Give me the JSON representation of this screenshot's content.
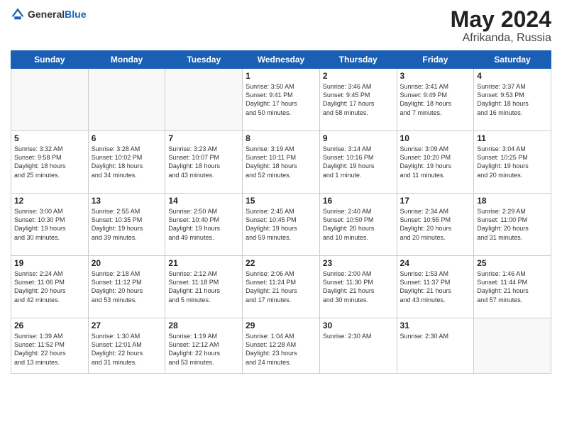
{
  "logo": {
    "general": "General",
    "blue": "Blue"
  },
  "title": {
    "month_year": "May 2024",
    "location": "Afrikanda, Russia"
  },
  "headers": [
    "Sunday",
    "Monday",
    "Tuesday",
    "Wednesday",
    "Thursday",
    "Friday",
    "Saturday"
  ],
  "weeks": [
    [
      {
        "day": "",
        "text": ""
      },
      {
        "day": "",
        "text": ""
      },
      {
        "day": "",
        "text": ""
      },
      {
        "day": "1",
        "text": "Sunrise: 3:50 AM\nSunset: 9:41 PM\nDaylight: 17 hours\nand 50 minutes."
      },
      {
        "day": "2",
        "text": "Sunrise: 3:46 AM\nSunset: 9:45 PM\nDaylight: 17 hours\nand 58 minutes."
      },
      {
        "day": "3",
        "text": "Sunrise: 3:41 AM\nSunset: 9:49 PM\nDaylight: 18 hours\nand 7 minutes."
      },
      {
        "day": "4",
        "text": "Sunrise: 3:37 AM\nSunset: 9:53 PM\nDaylight: 18 hours\nand 16 minutes."
      }
    ],
    [
      {
        "day": "5",
        "text": "Sunrise: 3:32 AM\nSunset: 9:58 PM\nDaylight: 18 hours\nand 25 minutes."
      },
      {
        "day": "6",
        "text": "Sunrise: 3:28 AM\nSunset: 10:02 PM\nDaylight: 18 hours\nand 34 minutes."
      },
      {
        "day": "7",
        "text": "Sunrise: 3:23 AM\nSunset: 10:07 PM\nDaylight: 18 hours\nand 43 minutes."
      },
      {
        "day": "8",
        "text": "Sunrise: 3:19 AM\nSunset: 10:11 PM\nDaylight: 18 hours\nand 52 minutes."
      },
      {
        "day": "9",
        "text": "Sunrise: 3:14 AM\nSunset: 10:16 PM\nDaylight: 19 hours\nand 1 minute."
      },
      {
        "day": "10",
        "text": "Sunrise: 3:09 AM\nSunset: 10:20 PM\nDaylight: 19 hours\nand 11 minutes."
      },
      {
        "day": "11",
        "text": "Sunrise: 3:04 AM\nSunset: 10:25 PM\nDaylight: 19 hours\nand 20 minutes."
      }
    ],
    [
      {
        "day": "12",
        "text": "Sunrise: 3:00 AM\nSunset: 10:30 PM\nDaylight: 19 hours\nand 30 minutes."
      },
      {
        "day": "13",
        "text": "Sunrise: 2:55 AM\nSunset: 10:35 PM\nDaylight: 19 hours\nand 39 minutes."
      },
      {
        "day": "14",
        "text": "Sunrise: 2:50 AM\nSunset: 10:40 PM\nDaylight: 19 hours\nand 49 minutes."
      },
      {
        "day": "15",
        "text": "Sunrise: 2:45 AM\nSunset: 10:45 PM\nDaylight: 19 hours\nand 59 minutes."
      },
      {
        "day": "16",
        "text": "Sunrise: 2:40 AM\nSunset: 10:50 PM\nDaylight: 20 hours\nand 10 minutes."
      },
      {
        "day": "17",
        "text": "Sunrise: 2:34 AM\nSunset: 10:55 PM\nDaylight: 20 hours\nand 20 minutes."
      },
      {
        "day": "18",
        "text": "Sunrise: 2:29 AM\nSunset: 11:00 PM\nDaylight: 20 hours\nand 31 minutes."
      }
    ],
    [
      {
        "day": "19",
        "text": "Sunrise: 2:24 AM\nSunset: 11:06 PM\nDaylight: 20 hours\nand 42 minutes."
      },
      {
        "day": "20",
        "text": "Sunrise: 2:18 AM\nSunset: 11:12 PM\nDaylight: 20 hours\nand 53 minutes."
      },
      {
        "day": "21",
        "text": "Sunrise: 2:12 AM\nSunset: 11:18 PM\nDaylight: 21 hours\nand 5 minutes."
      },
      {
        "day": "22",
        "text": "Sunrise: 2:06 AM\nSunset: 11:24 PM\nDaylight: 21 hours\nand 17 minutes."
      },
      {
        "day": "23",
        "text": "Sunrise: 2:00 AM\nSunset: 11:30 PM\nDaylight: 21 hours\nand 30 minutes."
      },
      {
        "day": "24",
        "text": "Sunrise: 1:53 AM\nSunset: 11:37 PM\nDaylight: 21 hours\nand 43 minutes."
      },
      {
        "day": "25",
        "text": "Sunrise: 1:46 AM\nSunset: 11:44 PM\nDaylight: 21 hours\nand 57 minutes."
      }
    ],
    [
      {
        "day": "26",
        "text": "Sunrise: 1:39 AM\nSunset: 11:52 PM\nDaylight: 22 hours\nand 13 minutes."
      },
      {
        "day": "27",
        "text": "Sunrise: 1:30 AM\nSunset: 12:01 AM\nDaylight: 22 hours\nand 31 minutes."
      },
      {
        "day": "28",
        "text": "Sunrise: 1:19 AM\nSunset: 12:12 AM\nDaylight: 22 hours\nand 53 minutes."
      },
      {
        "day": "29",
        "text": "Sunrise: 1:04 AM\nSunset: 12:28 AM\nDaylight: 23 hours\nand 24 minutes."
      },
      {
        "day": "30",
        "text": "Sunrise: 2:30 AM"
      },
      {
        "day": "31",
        "text": "Sunrise: 2:30 AM"
      },
      {
        "day": "",
        "text": ""
      }
    ]
  ]
}
